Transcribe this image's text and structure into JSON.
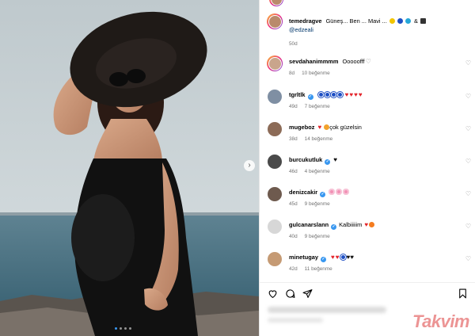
{
  "post": {
    "username": "temedragve",
    "caption": "Güneş... Ben ... Mavi ...",
    "mention": "@edzeali",
    "age": "50d"
  },
  "comments": [
    {
      "username": "sevdahanimmmm",
      "text": "Ooooofff",
      "age": "8d",
      "likes": "10 beğenme",
      "verified": false,
      "avatar_color": "#c9a58c",
      "ring": true
    },
    {
      "username": "tgrltlk",
      "text": "",
      "age": "49d",
      "likes": "7 beğenme",
      "verified": true,
      "avatar_color": "#7f8fa3",
      "ring": false
    },
    {
      "username": "mugeboz",
      "text": "çok güzelsin",
      "age": "38d",
      "likes": "14 beğenme",
      "verified": false,
      "avatar_color": "#8c6b57",
      "ring": false
    },
    {
      "username": "burcukutluk",
      "text": "",
      "age": "46d",
      "likes": "4 beğenme",
      "verified": true,
      "avatar_color": "#4a4a4a",
      "ring": false
    },
    {
      "username": "denizcakir",
      "text": "",
      "age": "45d",
      "likes": "9 beğenme",
      "verified": true,
      "avatar_color": "#6e5a4e",
      "ring": false
    },
    {
      "username": "gulcanarslann",
      "text": "Kalbiiiiim",
      "age": "40d",
      "likes": "9 beğenme",
      "verified": true,
      "avatar_color": "#d7d7d7",
      "ring": false
    },
    {
      "username": "minetugay",
      "text": "",
      "age": "42d",
      "likes": "11 beğenme",
      "verified": true,
      "avatar_color": "#c59a74",
      "ring": false
    }
  ],
  "watermark": "Takvim",
  "icons": [
    "heart-icon",
    "comment-icon",
    "share-icon",
    "bookmark-icon",
    "chevron-right-icon"
  ],
  "colors": {
    "accent": "#3897f0",
    "link": "#00376b",
    "red_heart": "#e3242b"
  }
}
